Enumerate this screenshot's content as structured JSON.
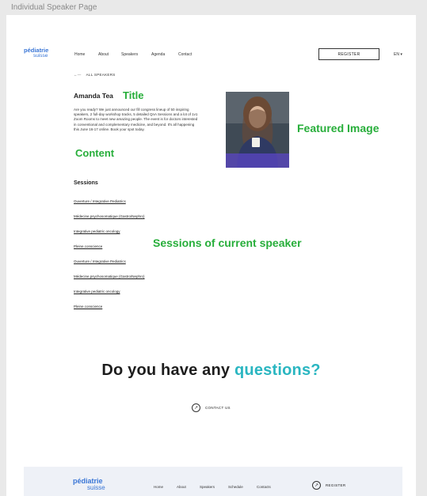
{
  "frame": {
    "title": "Individual Speaker Page"
  },
  "header": {
    "logo": {
      "line1": "pédiatrie",
      "line2": "suisse"
    },
    "nav": [
      "Home",
      "About",
      "Speakers",
      "Agenda",
      "Contact"
    ],
    "register_label": "REGISTER",
    "language": "EN ▾"
  },
  "back_link": {
    "arrow": "←—",
    "label": "ALL SPEAKERS"
  },
  "speaker": {
    "name": "Amanda Tea",
    "bio": "Are you ready? We just announced our fill congress lineup of 50 inspiring speakers, 2 full-day workshop tracks, 5 detailed QnA Sessions and a lot of 1v1 Zoom Rooms to meet new amazing people. The event is for doctors interested in conventional and complementary medicine, and beyond. It's all happening this June 16-17 online. Book your spot today."
  },
  "annotations": {
    "title": "Title",
    "content": "Content",
    "featured_image": "Featured Image",
    "sessions": "Sessions of current speaker"
  },
  "sessions": {
    "heading": "Sessions",
    "items": [
      "Ouverture / Integrative Pediatrics",
      "Médecine psychosomatique (Gastro/Nephro)",
      "Integrative pediatric oncology",
      "Pleine conscience",
      "Ouverture / Integrative Pediatrics",
      "Médecine psychosomatique (Gastro/Nephro)",
      "Integrative pediatric oncology",
      "Pleine conscience"
    ]
  },
  "cta": {
    "text_before": "Do you have any ",
    "text_accent": "questions?",
    "contact_label": "CONTACT US",
    "accent_color": "#2ab6c1"
  },
  "footer": {
    "logo": {
      "line1": "pédiatrie",
      "line2": "suisse"
    },
    "nav": [
      "Home",
      "About",
      "Speakers",
      "Schedule",
      "Contacts"
    ],
    "register_label": "REGISTER"
  }
}
